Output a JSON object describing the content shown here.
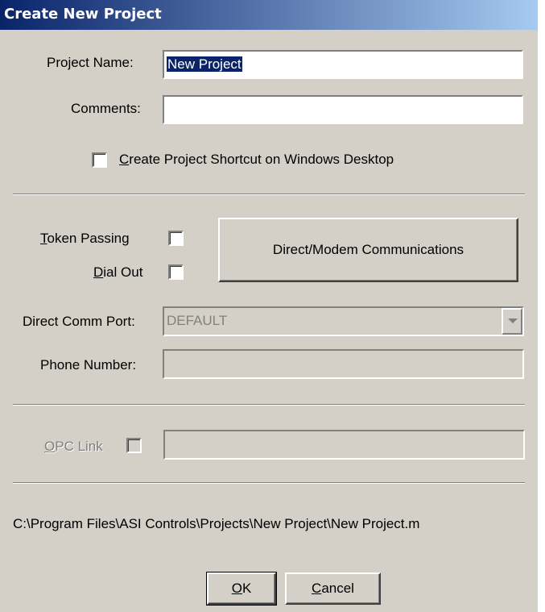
{
  "window": {
    "title": "Create New Project"
  },
  "project_name": {
    "label": "Project Name:",
    "value": "New Project"
  },
  "comments": {
    "label": "Comments:",
    "value": ""
  },
  "shortcut": {
    "accel": "C",
    "label_rest": "reate Project Shortcut on Windows Desktop",
    "checked": false
  },
  "token_passing": {
    "accel": "T",
    "label_rest": "oken Passing",
    "checked": false
  },
  "dial_out": {
    "accel": "D",
    "label_rest": "ial Out",
    "checked": false
  },
  "direct_modem_button": {
    "label": "Direct/Modem Communications"
  },
  "comm_port": {
    "label": "Direct Comm Port:",
    "value": "DEFAULT"
  },
  "phone_number": {
    "label": "Phone Number:",
    "value": ""
  },
  "opc_link": {
    "accel": "O",
    "label_rest": "PC Link",
    "checked": false,
    "value": ""
  },
  "path": "C:\\Program Files\\ASI Controls\\Projects\\New Project\\New Project.m",
  "ok_button": {
    "accel": "O",
    "label_rest": "K"
  },
  "cancel_button": {
    "accel": "C",
    "label_rest": "ancel"
  },
  "colors": {
    "face": "#d4d0c8",
    "title_start": "#0a246a",
    "title_end": "#a6caf0"
  }
}
